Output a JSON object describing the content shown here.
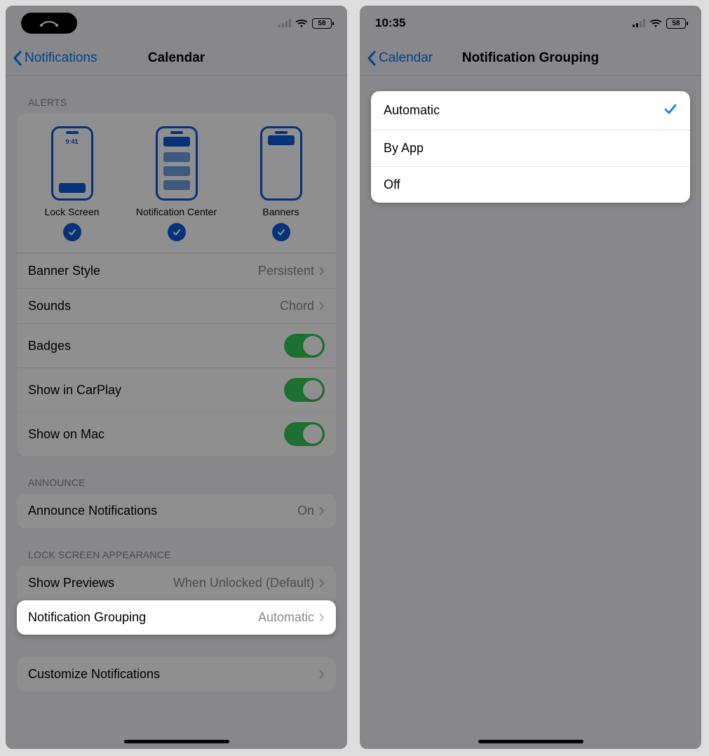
{
  "statusTime": "10:35",
  "battery": "58",
  "left": {
    "back": "Notifications",
    "title": "Calendar",
    "sections": {
      "alerts": {
        "header": "ALERTS",
        "lockScreenTime": "9:41",
        "lockScreen": "Lock Screen",
        "notifCenter": "Notification Center",
        "banners": "Banners",
        "bannerStyleLabel": "Banner Style",
        "bannerStyleValue": "Persistent",
        "soundsLabel": "Sounds",
        "soundsValue": "Chord",
        "badgesLabel": "Badges",
        "carplayLabel": "Show in CarPlay",
        "macLabel": "Show on Mac"
      },
      "announce": {
        "header": "ANNOUNCE",
        "label": "Announce Notifications",
        "value": "On"
      },
      "lockAppearance": {
        "header": "LOCK SCREEN APPEARANCE",
        "previewsLabel": "Show Previews",
        "previewsValue": "When Unlocked (Default)",
        "groupingLabel": "Notification Grouping",
        "groupingValue": "Automatic"
      },
      "customize": {
        "label": "Customize Notifications"
      }
    }
  },
  "right": {
    "back": "Calendar",
    "title": "Notification Grouping",
    "options": {
      "automatic": "Automatic",
      "byApp": "By App",
      "off": "Off"
    }
  }
}
